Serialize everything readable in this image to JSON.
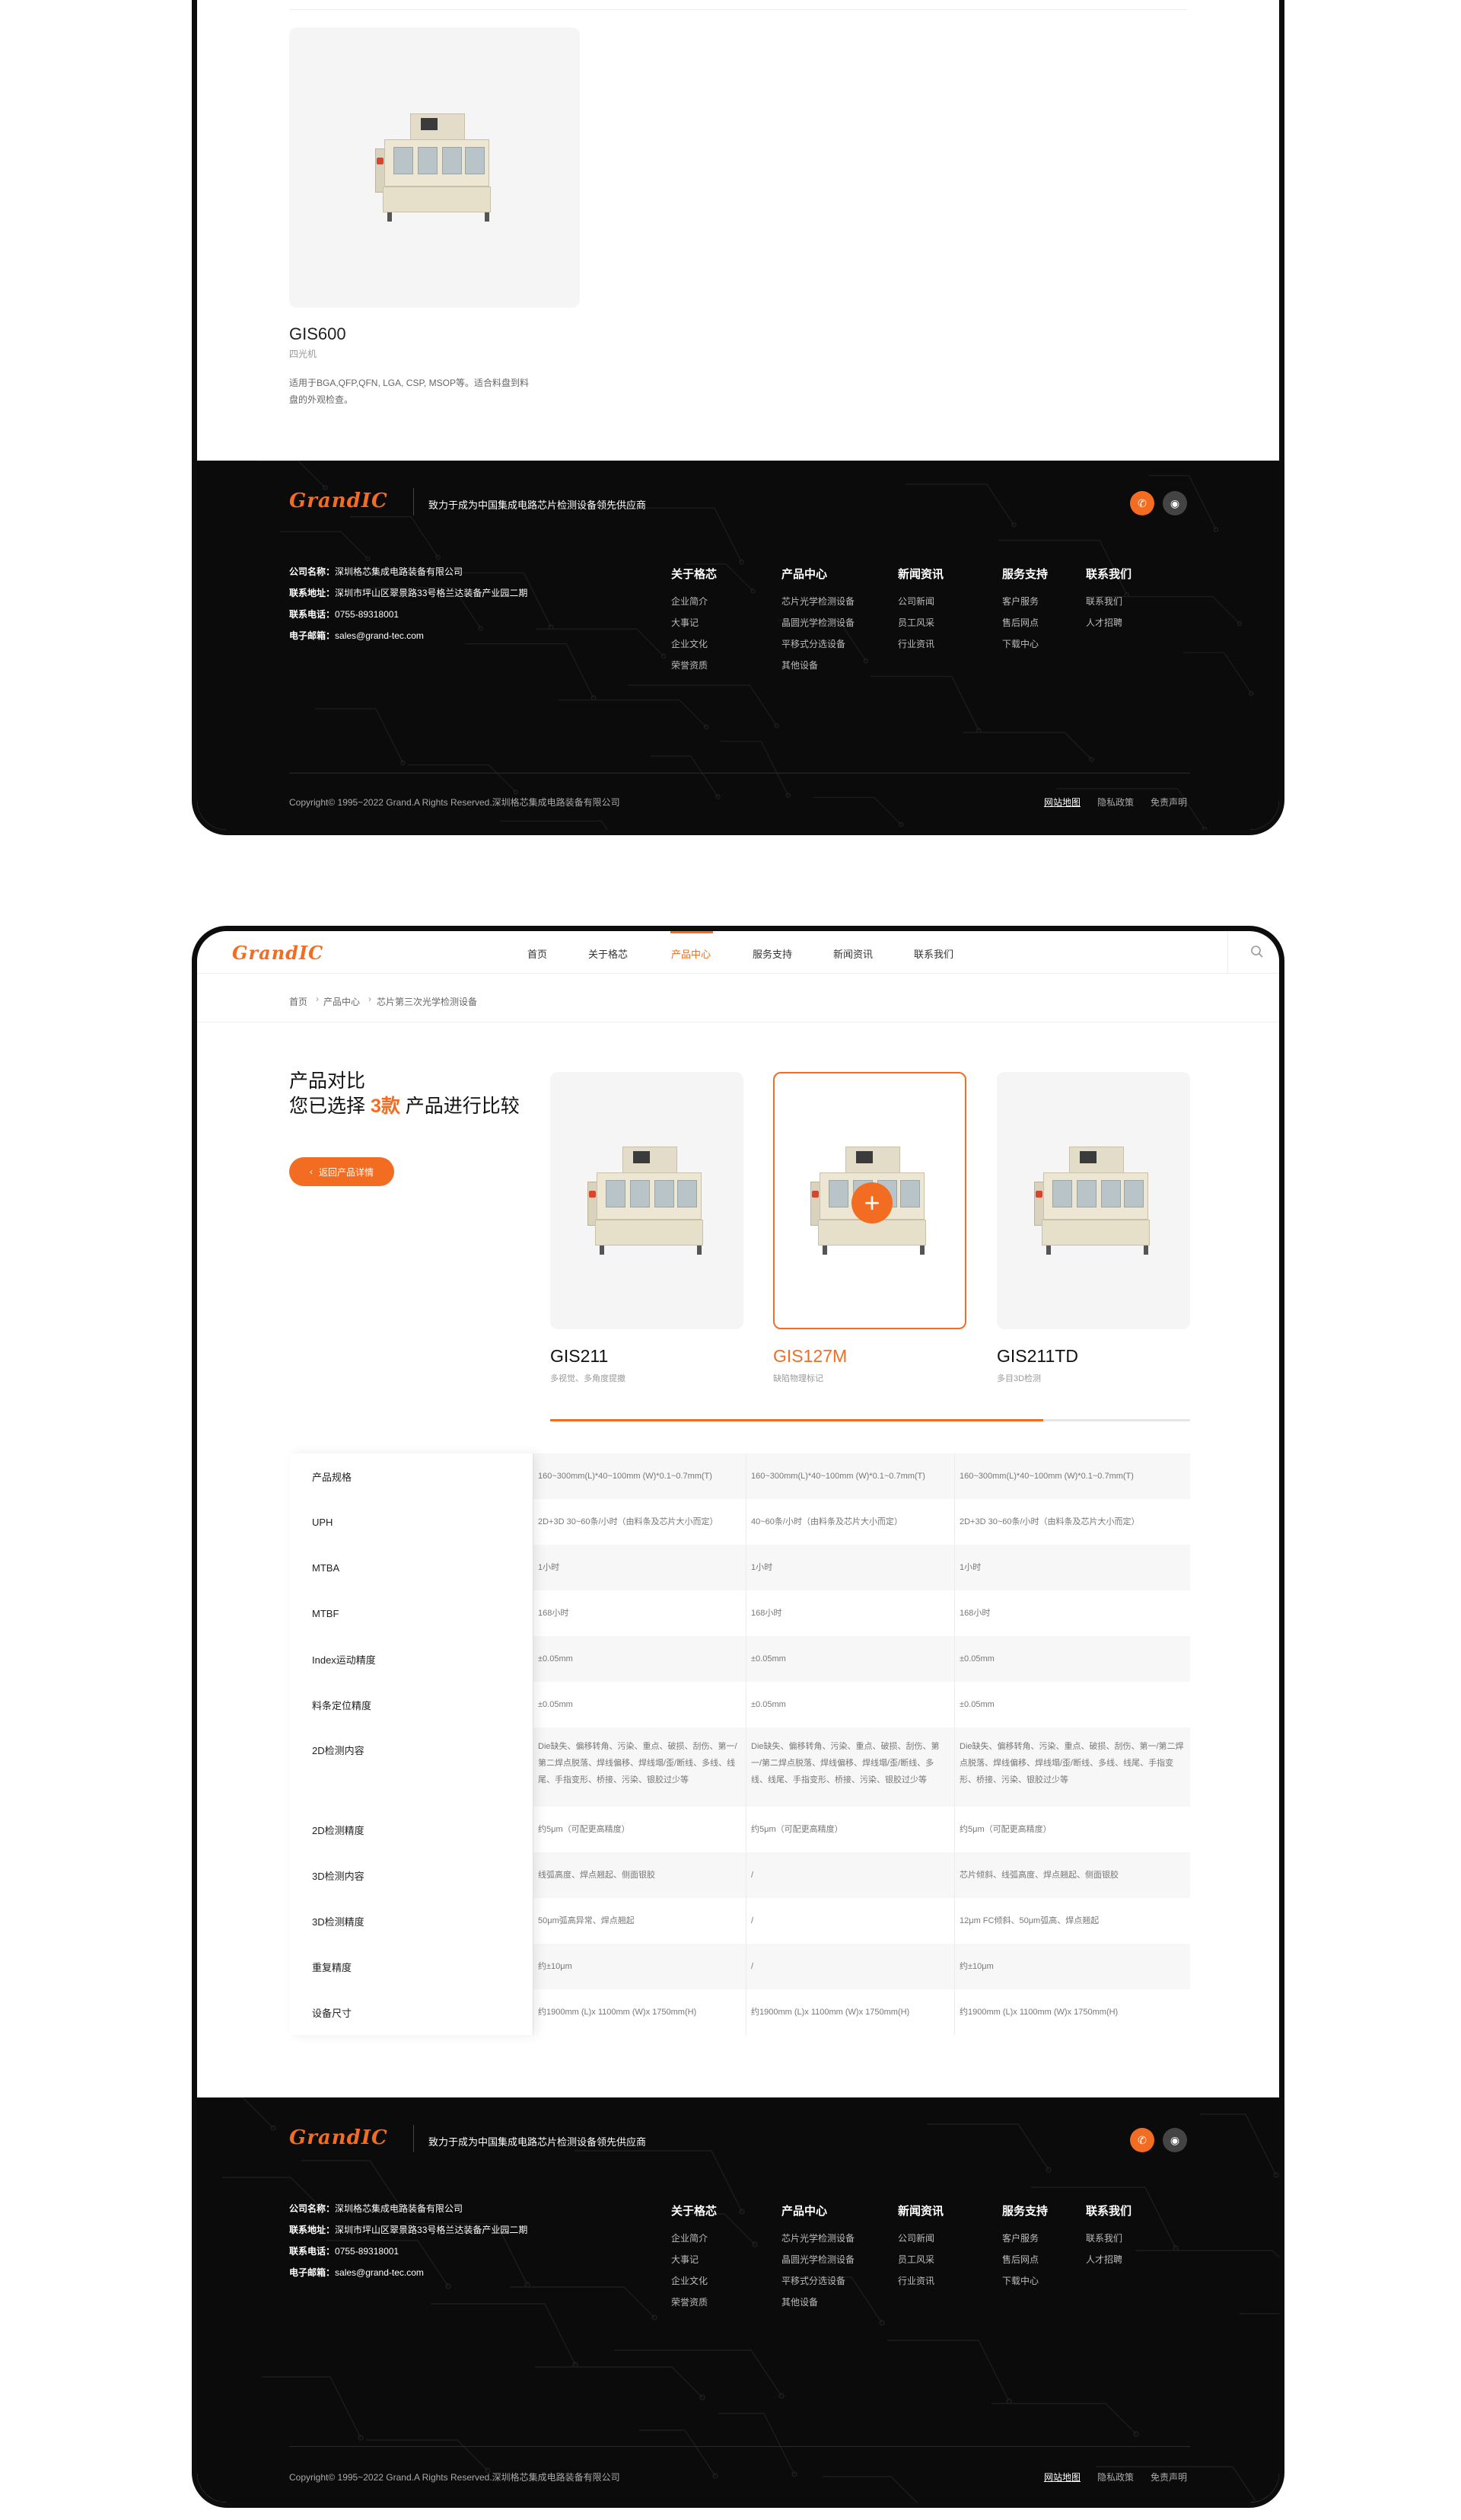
{
  "colors": {
    "accent": "#f26d21",
    "footer_bg": "#0b0b0b"
  },
  "top_product": {
    "name": "GIS600",
    "type": "四光机",
    "desc": "适用于BGA,QFP,QFN, LGA, CSP, MSOP等。适合料盘到料盘的外观检查。"
  },
  "footer": {
    "logo": "GrandIC",
    "slogan": "致力于成为中国集成电路芯片检测设备领先供应商",
    "social": [
      {
        "icon": "wechat-icon",
        "glyph": "✆"
      },
      {
        "icon": "weibo-icon",
        "glyph": "◉"
      }
    ],
    "company": {
      "name_label": "公司名称：",
      "name_value": "深圳格芯集成电路装备有限公司",
      "addr_label": "联系地址：",
      "addr_value": "深圳市坪山区翠景路33号格兰达装备产业园二期",
      "tel_label": "联系电话：",
      "tel_value": "0755-89318001",
      "mail_label": "电子邮箱：",
      "mail_value": "sales@grand-tec.com"
    },
    "columns": [
      {
        "title": "关于格芯",
        "items": [
          "企业简介",
          "大事记",
          "企业文化",
          "荣誉资质"
        ]
      },
      {
        "title": "产品中心",
        "items": [
          "芯片光学检测设备",
          "晶圆光学检测设备",
          "平移式分选设备",
          "其他设备"
        ]
      },
      {
        "title": "新闻资讯",
        "items": [
          "公司新闻",
          "员工风采",
          "行业资讯"
        ]
      },
      {
        "title": "服务支持",
        "items": [
          "客户服务",
          "售后网点",
          "下载中心"
        ]
      },
      {
        "title": "联系我们",
        "items": [
          "联系我们",
          "人才招聘"
        ]
      }
    ],
    "copyright": "Copyright© 1995~2022 Grand.A Rights Reserved.深圳格芯集成电路装备有限公司",
    "legal": [
      "网站地图",
      "隐私政策",
      "免责声明"
    ]
  },
  "nav": {
    "logo": "GrandIC",
    "items": [
      "首页",
      "关于格芯",
      "产品中心",
      "服务支持",
      "新闻资讯",
      "联系我们"
    ],
    "active": "产品中心"
  },
  "breadcrumb": [
    "首页",
    "产品中心",
    "芯片第三次光学检测设备"
  ],
  "compare": {
    "title": "产品对比",
    "sub_prefix": "您已选择 ",
    "count": "3款",
    "sub_suffix": " 产品进行比较",
    "back_label": "返回产品详情",
    "progress": 0.77,
    "products": [
      {
        "name": "GIS211",
        "type": "多视觉、多角度提撤"
      },
      {
        "name": "GIS127M",
        "type": "缺陷物理标记"
      },
      {
        "name": "GIS211TD",
        "type": "多目3D检测"
      }
    ],
    "specs": [
      {
        "label": "产品规格",
        "values": [
          "160~300mm(L)*40~100mm (W)*0.1~0.7mm(T)",
          "160~300mm(L)*40~100mm (W)*0.1~0.7mm(T)",
          "160~300mm(L)*40~100mm (W)*0.1~0.7mm(T)"
        ]
      },
      {
        "label": "UPH",
        "values": [
          "2D+3D 30~60条/小时（由料条及芯片大小而定）",
          "40~60条/小时（由料条及芯片大小而定）",
          "2D+3D 30~60条/小时（由料条及芯片大小而定）"
        ]
      },
      {
        "label": "MTBA",
        "values": [
          "1小时",
          "1小时",
          "1小时"
        ]
      },
      {
        "label": "MTBF",
        "values": [
          "168小时",
          "168小时",
          "168小时"
        ]
      },
      {
        "label": "Index运动精度",
        "values": [
          "±0.05mm",
          "±0.05mm",
          "±0.05mm"
        ]
      },
      {
        "label": "料条定位精度",
        "values": [
          "±0.05mm",
          "±0.05mm",
          "±0.05mm"
        ]
      },
      {
        "label": "2D检测内容",
        "values": [
          "Die缺失、偏移转角、污染、重点、破损、刮伤、第一/第二焊点脱落、焊线偏移、焊线塌/歪/断线、多线、线尾、手指变形、桥接、污染、银胶过少等",
          "Die缺失、偏移转角、污染、重点、破损、刮伤、第一/第二焊点脱落、焊线偏移、焊线塌/歪/断线、多线、线尾、手指变形、桥接、污染、银胶过少等",
          "Die缺失、偏移转角、污染、重点、破损、刮伤、第一/第二焊点脱落、焊线偏移、焊线塌/歪/断线、多线、线尾、手指变形、桥接、污染、银胶过少等"
        ]
      },
      {
        "label": "2D检测精度",
        "values": [
          "约5μm（可配更高精度）",
          "约5μm（可配更高精度）",
          "约5μm（可配更高精度）"
        ]
      },
      {
        "label": "3D检测内容",
        "values": [
          "线弧高度、焊点翘起、侧面银胶",
          "/",
          "芯片倾斜、线弧高度、焊点翘起、侧面银胶"
        ]
      },
      {
        "label": "3D检测精度",
        "values": [
          "50μm弧高异常、焊点翘起",
          "/",
          "12μm FC倾斜、50μm弧高、焊点翘起"
        ]
      },
      {
        "label": "重复精度",
        "values": [
          "约±10μm",
          "/",
          "约±10μm"
        ]
      },
      {
        "label": "设备尺寸",
        "values": [
          "约1900mm (L)x 1100mm (W)x 1750mm(H)",
          "约1900mm (L)x 1100mm (W)x 1750mm(H)",
          "约1900mm (L)x 1100mm (W)x 1750mm(H)"
        ]
      }
    ]
  }
}
